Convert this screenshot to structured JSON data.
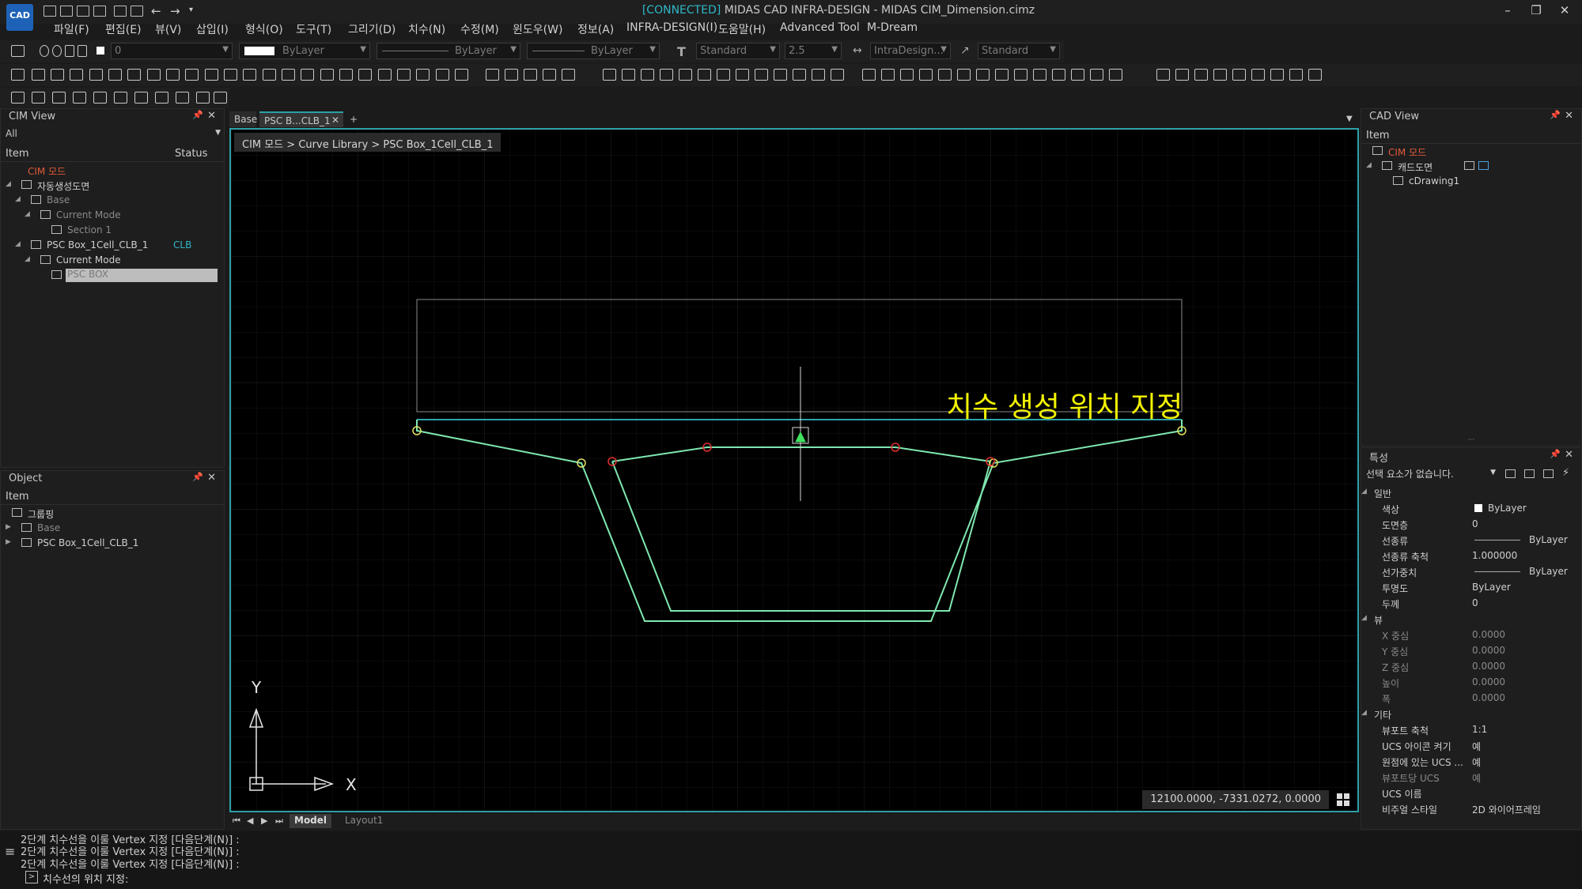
{
  "app": {
    "logo_text": "CAD",
    "connected_tag": "[CONNECTED]",
    "title": "MIDAS CAD INFRA-DESIGN - MIDAS CIM_Dimension.cimz",
    "window_controls": {
      "minimize": "–",
      "restore": "❐",
      "close": "✕"
    }
  },
  "menu": [
    "파일(F)",
    "편집(E)",
    "뷰(V)",
    "삽입(I)",
    "형식(O)",
    "도구(T)",
    "그리기(D)",
    "치수(N)",
    "수정(M)",
    "윈도우(W)",
    "정보(A)",
    "INFRA-DESIGN(I)",
    "도움말(H)",
    "Advanced Tool",
    "M-Dream"
  ],
  "toolbar": {
    "layer_value": "0",
    "color_value": "ByLayer",
    "linetype_value": "ByLayer",
    "lineweight_value": "ByLayer",
    "textstyle_value": "Standard",
    "textheight_value": "2.5",
    "dimstyle_value": "IntraDesign...",
    "multileader_value": "Standard"
  },
  "cim_view": {
    "title": "CIM View",
    "filter": "All",
    "col_item": "Item",
    "col_status": "Status",
    "rows": [
      {
        "label": "CIM 모드",
        "status": ""
      },
      {
        "label": "자동생성도면",
        "status": ""
      },
      {
        "label": "Base",
        "status": ""
      },
      {
        "label": "Current Mode",
        "status": ""
      },
      {
        "label": "Section 1",
        "status": ""
      },
      {
        "label": "PSC Box_1Cell_CLB_1",
        "status": "CLB"
      },
      {
        "label": "Current Mode",
        "status": ""
      },
      {
        "label": "PSC BOX",
        "status": ""
      }
    ]
  },
  "object_panel": {
    "title": "Object",
    "col_item": "Item",
    "rows": [
      "그룹핑",
      "Base",
      "PSC Box_1Cell_CLB_1"
    ]
  },
  "doc_tabs": {
    "tab1": "Base",
    "tab2": "PSC B...CLB_1",
    "add": "+"
  },
  "viewport": {
    "breadcrumb": "CIM 모드 > Curve Library > PSC Box_1Cell_CLB_1",
    "annotation": "치수 생성 위치 지정",
    "coords": "12100.0000, -7331.0272, 0.0000",
    "ucs_x": "X",
    "ucs_y": "Y",
    "accent_color": "#2e9fa6"
  },
  "layout_tabs": [
    "Model",
    "Layout1"
  ],
  "command": {
    "history": [
      "2단계 치수선을 이룰 Vertex 지정 [다음단계(N)] :",
      "2단계 치수선을 이룰 Vertex 지정 [다음단계(N)] :",
      "2단계 치수선을 이룰 Vertex 지정 [다음단계(N)] :"
    ],
    "prompt": "치수선의 위치 지정:"
  },
  "cad_view": {
    "title": "CAD View",
    "col_item": "Item",
    "rows": [
      "CIM 모드",
      "캐드도면",
      "cDrawing1"
    ]
  },
  "properties": {
    "title": "특성",
    "selection": "선택 요소가 없습니다.",
    "sections": [
      {
        "name": "일반",
        "items": [
          {
            "k": "색상",
            "v": "ByLayer"
          },
          {
            "k": "도면층",
            "v": "0"
          },
          {
            "k": "선종류",
            "v": "ByLayer"
          },
          {
            "k": "선종류 축척",
            "v": "1.000000"
          },
          {
            "k": "선가중치",
            "v": "ByLayer"
          },
          {
            "k": "투명도",
            "v": "ByLayer"
          },
          {
            "k": "두께",
            "v": "0"
          }
        ]
      },
      {
        "name": "뷰",
        "items": [
          {
            "k": "X 중심",
            "v": "0.0000"
          },
          {
            "k": "Y 중심",
            "v": "0.0000"
          },
          {
            "k": "Z 중심",
            "v": "0.0000"
          },
          {
            "k": "높이",
            "v": "0.0000"
          },
          {
            "k": "폭",
            "v": "0.0000"
          }
        ]
      },
      {
        "name": "기타",
        "items": [
          {
            "k": "뷰포트 축척",
            "v": "1:1"
          },
          {
            "k": "UCS 아이콘 켜기",
            "v": "예"
          },
          {
            "k": "원점에 있는 UCS ...",
            "v": "예"
          },
          {
            "k": "뷰포트당 UCS",
            "v": "예"
          },
          {
            "k": "UCS 이름",
            "v": ""
          },
          {
            "k": "비주얼 스타일",
            "v": "2D 와이어프레임"
          }
        ]
      }
    ]
  }
}
